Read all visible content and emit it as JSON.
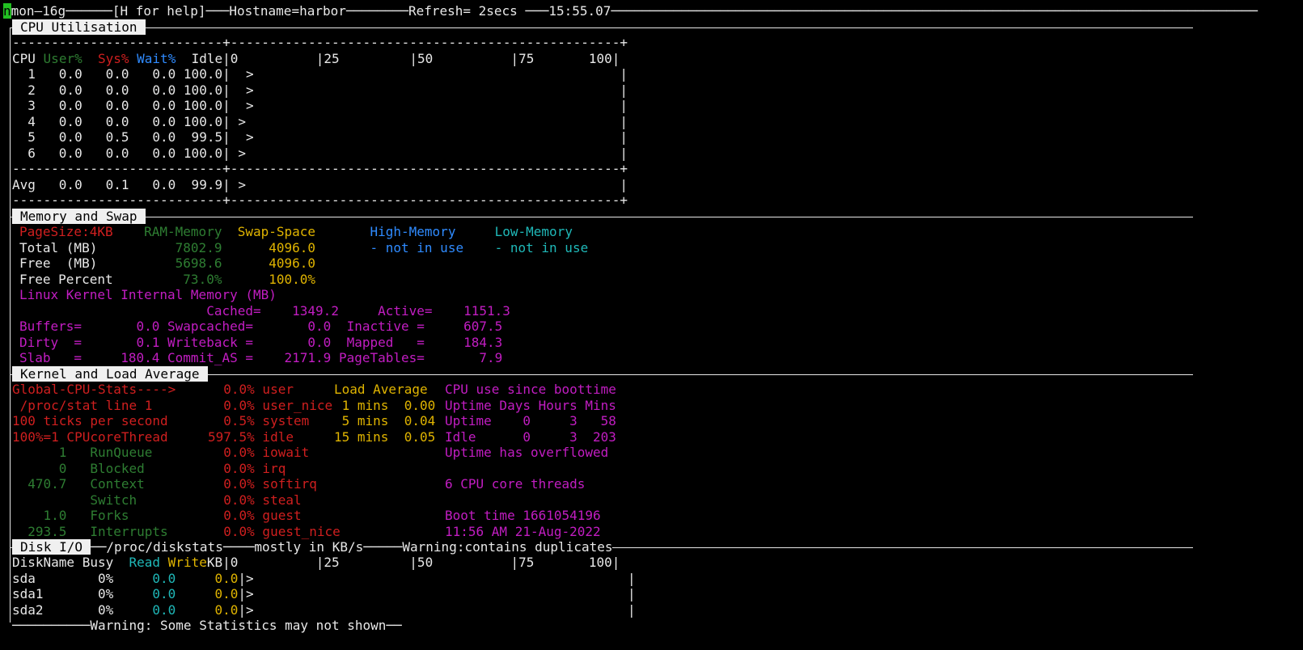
{
  "header": {
    "cursor_char": "n",
    "app": "mon—16g",
    "help": "[H for help]",
    "hostname": "Hostname=harbor",
    "refresh": "Refresh= 2secs",
    "time": "15:55.07"
  },
  "cpu": {
    "title": "CPU Utilisation",
    "sep": "---------------------------+--------------------------------------------------+",
    "col_cpu": "CPU",
    "col_user": "User%",
    "col_sys": "Sys%",
    "col_wait": "Wait%",
    "col_idle": "Idle",
    "scale": "|0          |25         |50          |75       100|",
    "rows": [
      "  1   0.0   0.0   0.0 100.0|  >                                               |",
      "  2   0.0   0.0   0.0 100.0|  >                                               |",
      "  3   0.0   0.0   0.0 100.0|  >                                               |",
      "  4   0.0   0.0   0.0 100.0| >                                                |",
      "  5   0.0   0.5   0.0  99.5|  >                                               |",
      "  6   0.0   0.0   0.0 100.0| >                                                |"
    ],
    "avg": "Avg   0.0   0.1   0.0  99.9| >                                                |"
  },
  "memory": {
    "title": "Memory and Swap",
    "pagesize": "PageSize:4KB",
    "ram_hdr": "RAM-Memory",
    "swap_hdr": "Swap-Space",
    "high_hdr": "High-Memory",
    "low_hdr": "Low-Memory",
    "total_label": "Total (MB)",
    "total_ram": "7802.9",
    "total_swap": "4096.0",
    "high_val": "- not in use",
    "low_val": "- not in use",
    "free_label": "Free  (MB)",
    "free_ram": "5698.6",
    "free_swap": "4096.0",
    "pct_label": "Free Percent",
    "pct_ram": "73.0%",
    "pct_swap": "100.0%",
    "kernel_hdr": "Linux Kernel Internal Memory (MB)",
    "k1": "                        Cached=    1349.2     Active=    1151.3",
    "k2": "Buffers=       0.0 Swapcached=       0.0  Inactive =     607.5",
    "k3": "Dirty  =       0.1 Writeback =       0.0  Mapped   =     184.3",
    "k4": "Slab   =     180.4 Commit_AS =    2171.9 PageTables=       7.9"
  },
  "kernel": {
    "title": "Kernel and Load Average",
    "l1a": "Global-CPU-Stats---->",
    "l2a": " /proc/stat line 1",
    "l3a": "100 ticks per second",
    "l4a": "100%=1 CPUcoreThread",
    "s1": "  0.0% user",
    "s2": "  0.0% user_nice",
    "s3": "  0.5% system",
    "s4": "597.5% idle",
    "s5": "  0.0% iowait",
    "s6": "  0.0% irq",
    "s7": "  0.0% softirq",
    "s8": "  0.0% steal",
    "s9": "  0.0% guest",
    "s10": "  0.0% guest_nice",
    "la_hdr": "Load Average",
    "la1": " 1 mins  0.00",
    "la2": " 5 mins  0.04",
    "la3": "15 mins  0.05",
    "up_hdr": "CPU use since boottime",
    "up1": "Uptime Days Hours Mins",
    "up2": "Uptime    0     3   58",
    "up3": "Idle      0     3  203",
    "up4": "Uptime has overflowed",
    "up5": "6 CPU core threads",
    "up6": "Boot time 1661054196",
    "up7": "11:56 AM 21-Aug-2022",
    "runq_v": "      1",
    "runq_l": "RunQueue",
    "blk_v": "      0",
    "blk_l": "Blocked",
    "ctx_v": "  470.7",
    "ctx_l": "Context",
    "sw_l": "Switch",
    "fork_v": "    1.0",
    "fork_l": "Forks",
    "int_v": "  293.5",
    "int_l": "Interrupts"
  },
  "disk": {
    "title": "Disk I/O",
    "src": "/proc/diskstats",
    "units": "mostly in KB/s",
    "warn": "Warning:contains duplicates",
    "hdr_name": "DiskName Busy",
    "hdr_read": "Read",
    "hdr_write": "Write",
    "hdr_kb": "KB",
    "rows": [
      {
        "name": "sda        0%",
        "read": "0.0",
        "write": "0.0"
      },
      {
        "name": "sda1       0%",
        "read": "0.0",
        "write": "0.0"
      },
      {
        "name": "sda2       0%",
        "read": "0.0",
        "write": "0.0"
      }
    ],
    "tail": "|>                                                |",
    "footer_warn": "Warning: Some Statistics may not shown"
  }
}
